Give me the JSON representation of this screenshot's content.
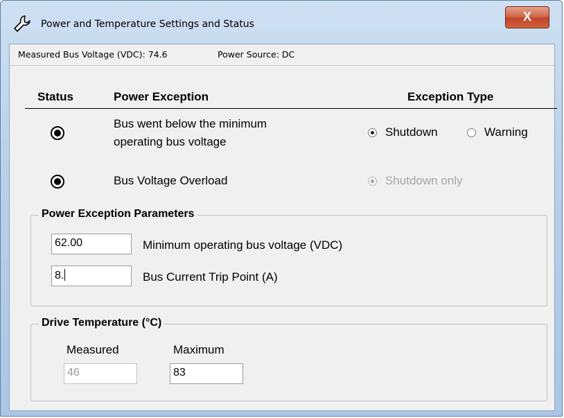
{
  "window": {
    "title": "Power and Temperature Settings and Status",
    "close_glyph": "X",
    "icon": "wrench-icon"
  },
  "statusbar": {
    "voltage": "Measured Bus Voltage (VDC): 74.6",
    "source": "Power Source: DC"
  },
  "headers": {
    "status": "Status",
    "exception": "Power Exception",
    "type": "Exception Type"
  },
  "exceptions": [
    {
      "description_line1": "Bus went below the minimum",
      "description_line2": "operating bus voltage",
      "options": [
        "Shutdown",
        "Warning"
      ],
      "selected": "Shutdown"
    },
    {
      "description": "Bus Voltage Overload",
      "option": "Shutdown only",
      "selected": "Shutdown only",
      "disabled": true
    }
  ],
  "params": {
    "legend": "Power Exception Parameters",
    "min_voltage": {
      "value": "62.00",
      "label": "Minimum operating bus voltage (VDC)"
    },
    "trip_point": {
      "value": "8.",
      "label": "Bus Current Trip Point (A)"
    }
  },
  "temperature": {
    "legend": "Drive Temperature (°C)",
    "measured_label": "Measured",
    "measured_value": "46",
    "maximum_label": "Maximum",
    "maximum_value": "83"
  },
  "colors": {
    "title_gradient": "#b9d1ea",
    "close": "#c2452a",
    "client_bg": "#f0f0f0"
  }
}
